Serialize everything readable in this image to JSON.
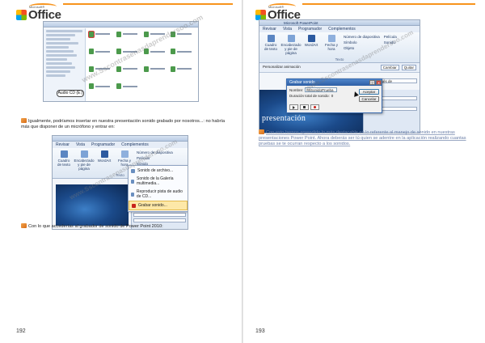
{
  "left_page": {
    "logo_small": "Microsoft®",
    "logo_text": "Office",
    "page_number": "192",
    "paragraph_1": "Igualmente, podríamos insertar en nuestra presentación sonido grabado por nosotros...: no habría más que disponer de un micrófono y entrar en:",
    "paragraph_2": "Con lo que accederías al grabador de sonido de Power Point 2010:",
    "screenshot_1": {
      "audio_chip": "Audio CD (E:)"
    },
    "screenshot_2": {
      "tabs": [
        "Revisar",
        "Vista",
        "Programador",
        "Complementos"
      ],
      "ribbon_buttons": [
        "Cuadro de texto",
        "Encabezado y pie de página",
        "WordArt",
        "Fecha y hora"
      ],
      "ribbon_side": [
        "Número de diapositiva",
        "Película",
        "Sonido"
      ],
      "group_label": "Texto",
      "menu_items": [
        "Sonido de archivo...",
        "Sonido de la Galería multimedia...",
        "Reproducir pista de audio de CD...",
        "Grabar sonido..."
      ],
      "pane_header": "Modificar Reproducir",
      "pane_label": "Inicio:",
      "pane_value": "Después de"
    }
  },
  "right_page": {
    "logo_small": "Microsoft®",
    "logo_text": "Office",
    "page_number": "193",
    "paragraph_1": "Con esto hemos aprendido lo más destacable en lo referente al manejo de sonido en nuestras presentaciones Power Point. Ahora deberás ser tú quien se adentre en la aplicación realizando cuantas pruebas se te ocurran respecto a los sonidos.",
    "screenshot_3": {
      "window_title": "Microsoft PowerPoint",
      "tabs": [
        "Revisar",
        "Vista",
        "Programador",
        "Complementos"
      ],
      "ribbon_buttons": [
        "Cuadro de texto",
        "Encabezado y pie de página",
        "WordArt",
        "Fecha y hora"
      ],
      "ribbon_side": [
        "Número de diapositiva",
        "Símbolo",
        "Objeto",
        "Película",
        "Sonido"
      ],
      "group_label": "Texto",
      "toolbar_buttons": [
        "Cambiar",
        "Quitar"
      ],
      "pane_title": "Personalizar animación",
      "pane_value": "Después de",
      "slide_title": "presentación",
      "dialog_title": "Grabar sonido",
      "name_label": "Nombre:",
      "name_value": "MiSonidoPrueba",
      "duration_label": "Duración total de sonido:",
      "duration_value": "0",
      "ok_label": "Aceptar",
      "cancel_label": "Cancelar"
    }
  },
  "watermark": "www.Sscontrasenasdaprendersoo.com",
  "colors": {
    "accent": "#f7941d",
    "link_text": "#6b7fa8",
    "ribbon_text": "#213b66",
    "dialog_title": "#2d5fa5"
  }
}
